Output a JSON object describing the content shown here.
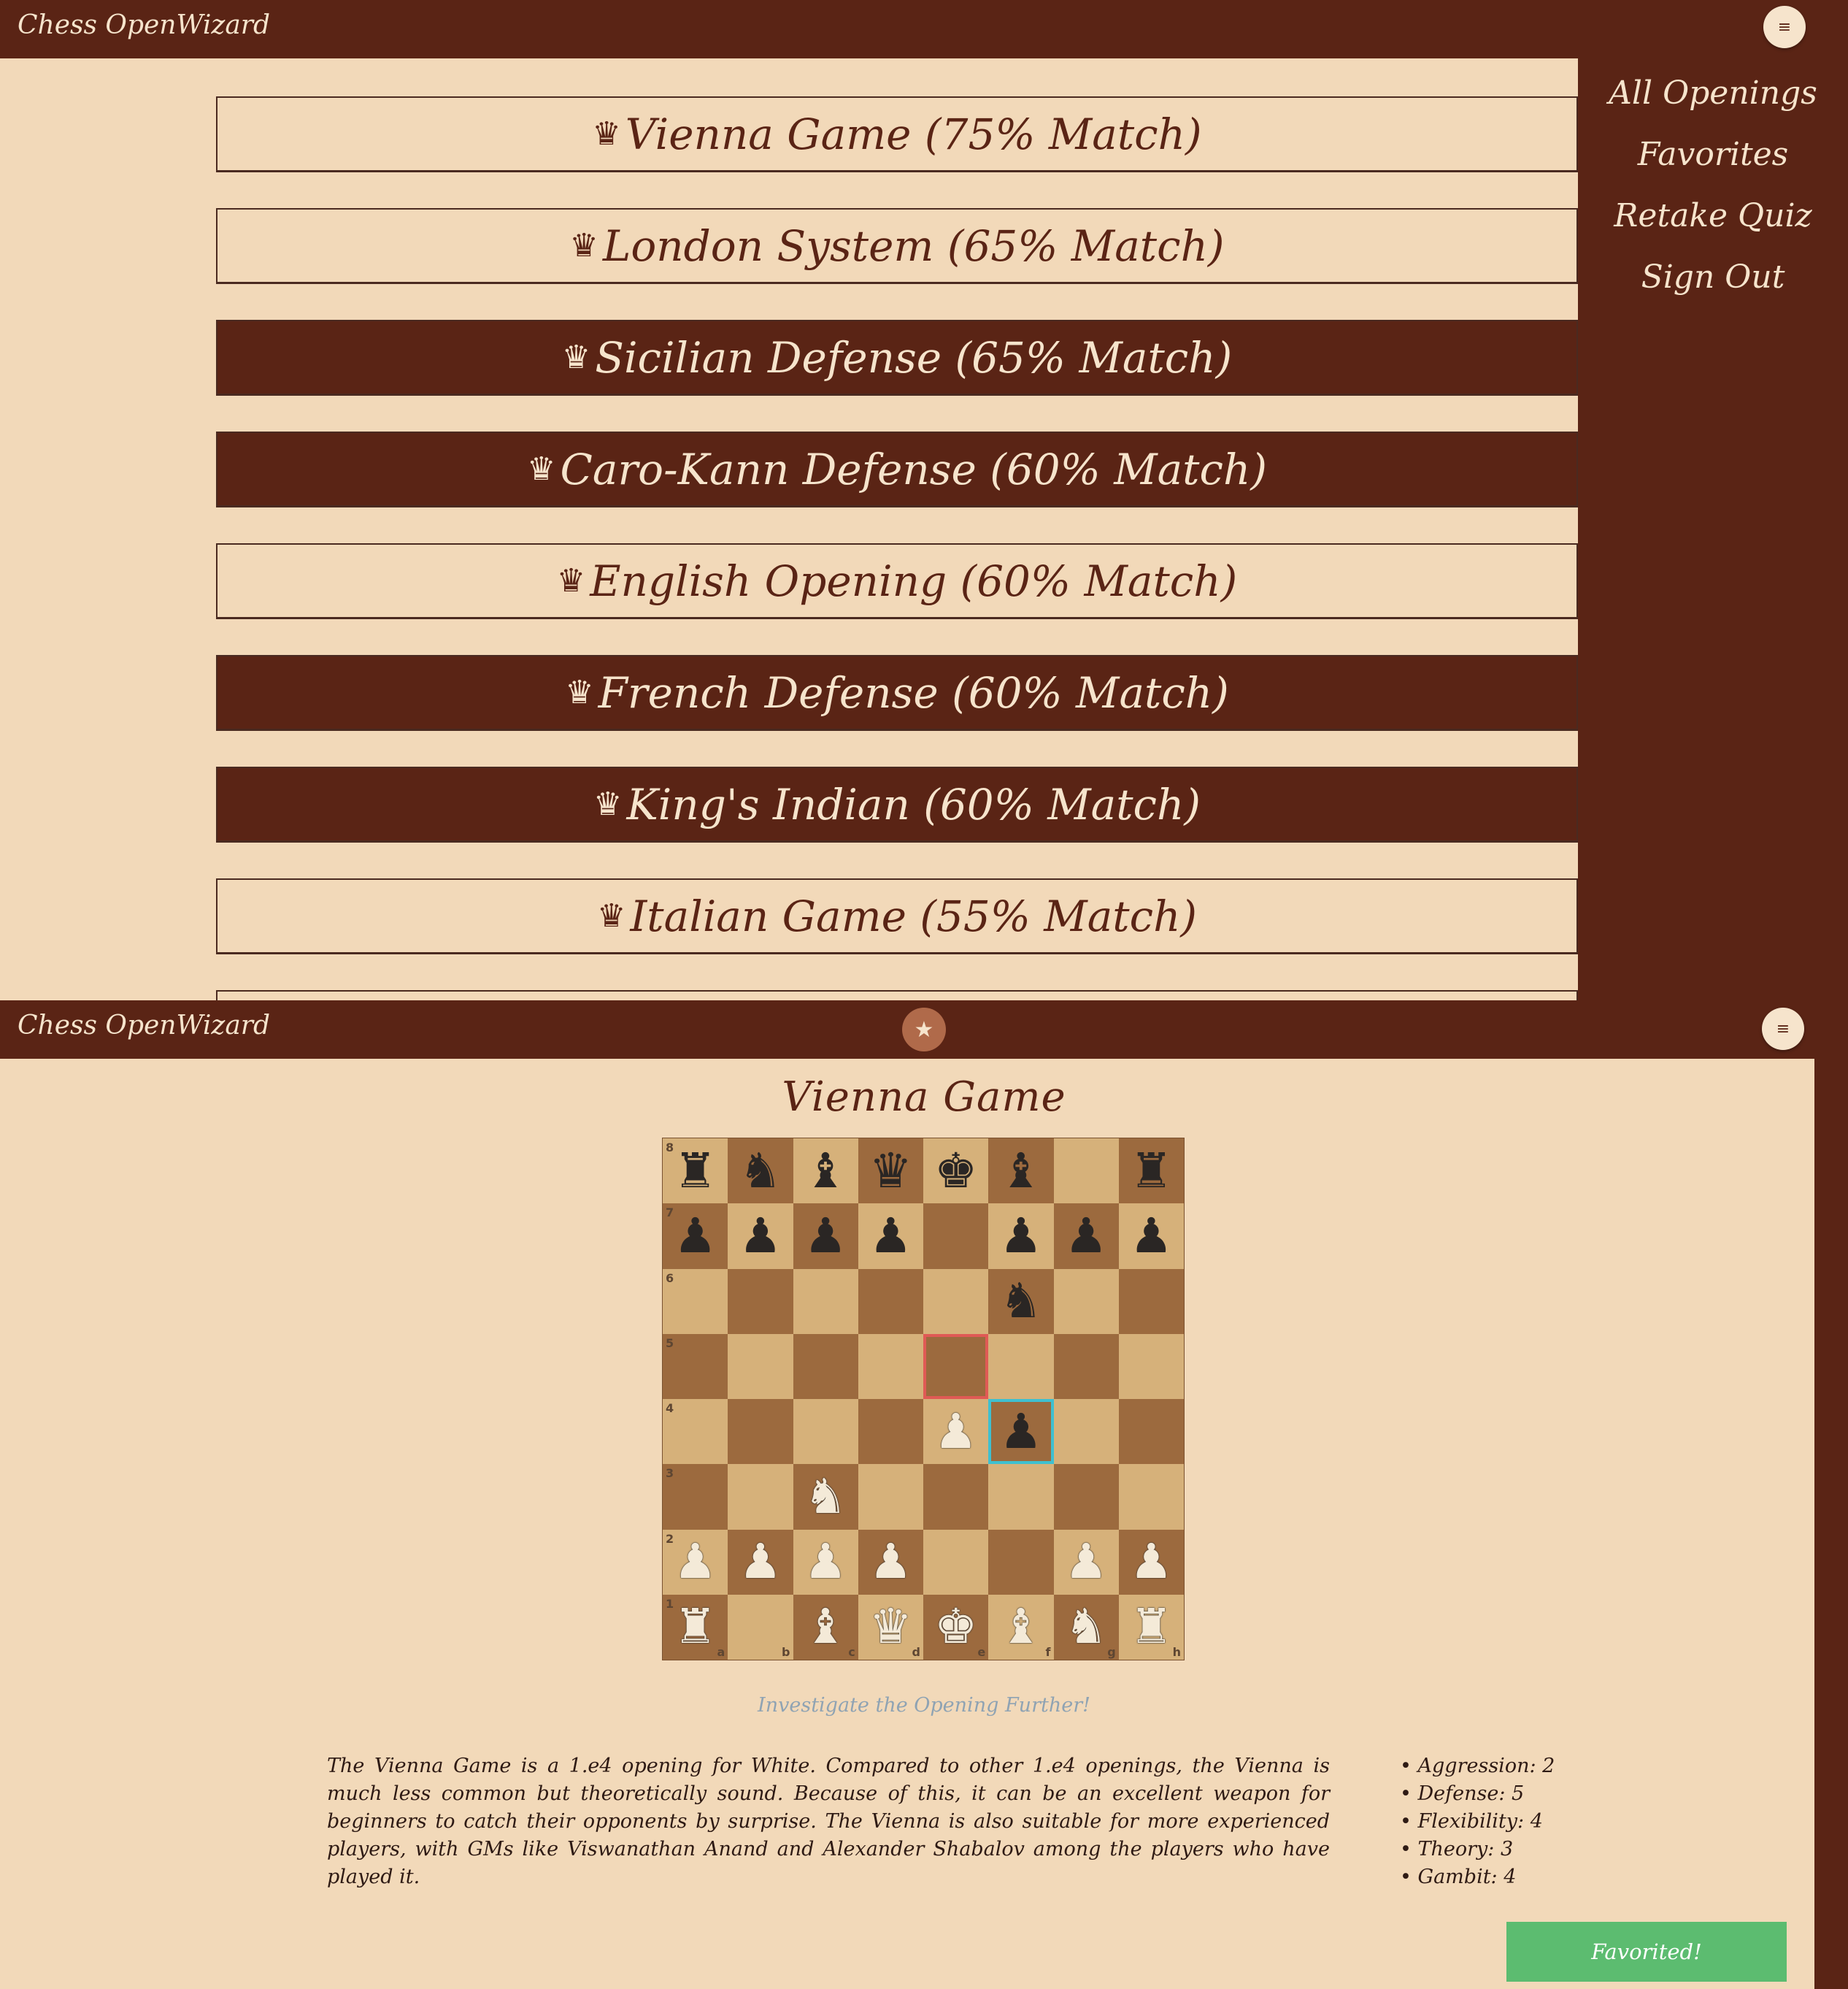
{
  "app_title": "Chess OpenWizard",
  "menu_icon": "≡",
  "results": [
    {
      "name": "Vienna Game (75% Match)",
      "style": "light"
    },
    {
      "name": "London System (65% Match)",
      "style": "light"
    },
    {
      "name": "Sicilian Defense (65% Match)",
      "style": "dark"
    },
    {
      "name": "Caro-Kann Defense (60% Match)",
      "style": "dark"
    },
    {
      "name": "English Opening (60% Match)",
      "style": "light"
    },
    {
      "name": "French Defense (60% Match)",
      "style": "dark"
    },
    {
      "name": "King's Indian (60% Match)",
      "style": "dark"
    },
    {
      "name": "Italian Game (55% Match)",
      "style": "light"
    }
  ],
  "side_menu": [
    "All Openings",
    "Favorites",
    "Retake Quiz",
    "Sign Out"
  ],
  "detail": {
    "star_icon": "★",
    "title": "Vienna Game",
    "board_ranks": [
      [
        "r",
        "n",
        "b",
        "q",
        "k",
        "b",
        "",
        "r"
      ],
      [
        "p",
        "p",
        "p",
        "p",
        "",
        "p",
        "p",
        "p"
      ],
      [
        "",
        "",
        "",
        "",
        "",
        "n",
        "",
        ""
      ],
      [
        "",
        "",
        "",
        "",
        "",
        "",
        "",
        ""
      ],
      [
        "",
        "",
        "",
        "",
        "P",
        "p",
        "",
        ""
      ],
      [
        "",
        "",
        "N",
        "",
        "",
        "",
        "",
        ""
      ],
      [
        "P",
        "P",
        "P",
        "P",
        "",
        "",
        "P",
        "P"
      ],
      [
        "R",
        "",
        "B",
        "Q",
        "K",
        "B",
        "N",
        "R"
      ]
    ],
    "highlight_from": "e5",
    "highlight_to": "f4",
    "rank_labels": [
      "8",
      "7",
      "6",
      "5",
      "4",
      "3",
      "2",
      "1"
    ],
    "file_labels": [
      "a",
      "b",
      "c",
      "d",
      "e",
      "f",
      "g",
      "h"
    ],
    "investigate_link": "Investigate the Opening Further!",
    "description": "The Vienna Game is a 1.e4 opening for White. Compared to other 1.e4 openings, the Vienna is much less common but theoretically sound. Because of this, it can be an excellent weapon for beginners to catch their opponents by surprise. The Vienna is also suitable for more experienced players, with GMs like Viswanathan Anand and Alexander Shabalov among the players who have played it.",
    "stats": [
      "Aggression: 2",
      "Defense: 5",
      "Flexibility: 4",
      "Theory: 3",
      "Gambit: 4"
    ],
    "favorite_button": "Favorited!"
  },
  "colors": {
    "brand_brown": "#5a2415",
    "cream": "#f2d9b9",
    "favorite_green": "#5cbc70"
  }
}
